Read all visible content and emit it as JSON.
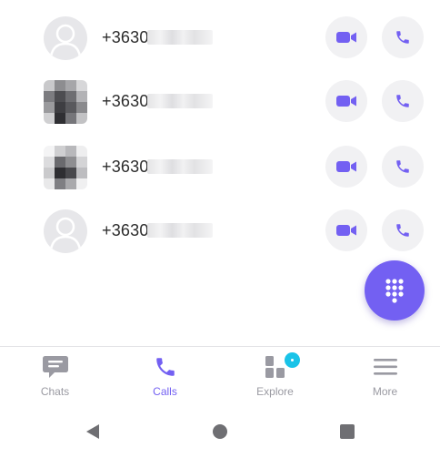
{
  "calls": [
    {
      "number_prefix": "+3630",
      "avatar": "default-avatar-icon"
    },
    {
      "number_prefix": "+3630",
      "avatar": "pixelated-photo"
    },
    {
      "number_prefix": "+3630",
      "avatar": "pixelated-photo"
    },
    {
      "number_prefix": "+3630",
      "avatar": "default-avatar-icon"
    }
  ],
  "actions": {
    "video_icon": "video-camera-icon",
    "voice_icon": "phone-icon"
  },
  "fab": {
    "icon": "dialpad-icon"
  },
  "nav": {
    "tabs": [
      {
        "label": "Chats",
        "icon": "chat-bubble-icon",
        "active": false
      },
      {
        "label": "Calls",
        "icon": "phone-icon",
        "active": true
      },
      {
        "label": "Explore",
        "icon": "explore-grid-icon",
        "active": false,
        "badge": true
      },
      {
        "label": "More",
        "icon": "hamburger-menu-icon",
        "active": false
      }
    ]
  },
  "system_nav": {
    "buttons": [
      "back-triangle-icon",
      "home-circle-icon",
      "recents-square-icon"
    ]
  },
  "colors": {
    "accent": "#7360f2",
    "badge": "#19c3e8",
    "inactive": "#9a9aa2",
    "button_bg": "#f1f1f3"
  }
}
